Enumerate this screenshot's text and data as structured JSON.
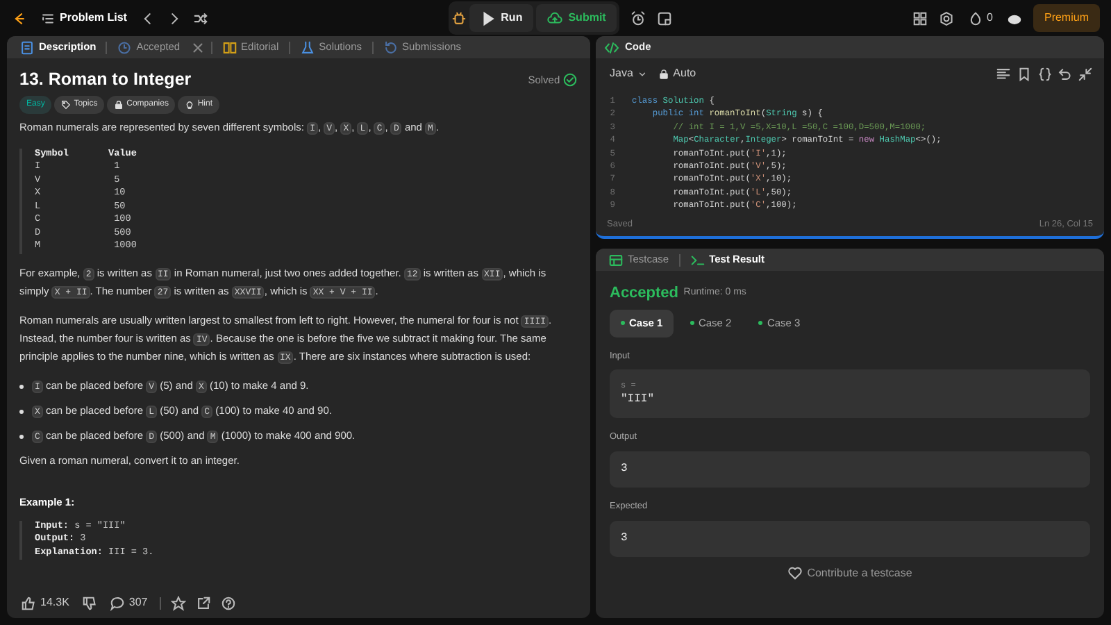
{
  "topbar": {
    "problem_list": "Problem List",
    "run": "Run",
    "submit": "Submit",
    "streak": "0",
    "premium": "Premium"
  },
  "description_tabs": [
    {
      "label": "Description",
      "selected": true,
      "closable": false
    },
    {
      "label": "Accepted",
      "selected": false,
      "closable": true
    },
    {
      "label": "Editorial",
      "selected": false,
      "closable": false
    },
    {
      "label": "Solutions",
      "selected": false,
      "closable": false
    },
    {
      "label": "Submissions",
      "selected": false,
      "closable": false
    }
  ],
  "problem": {
    "title": "13. Roman to Integer",
    "status": "Solved",
    "difficulty": "Easy",
    "tags": [
      "Topics",
      "Companies",
      "Hint"
    ],
    "blocks": [
      {
        "kind": "para",
        "parts": [
          {
            "kind": "text",
            "text": "Roman numerals are represented by seven different symbols: "
          },
          {
            "kind": "code",
            "text": "I"
          },
          {
            "kind": "text",
            "text": ", "
          },
          {
            "kind": "code",
            "text": "V"
          },
          {
            "kind": "text",
            "text": ", "
          },
          {
            "kind": "code",
            "text": "X"
          },
          {
            "kind": "text",
            "text": ", "
          },
          {
            "kind": "code",
            "text": "L"
          },
          {
            "kind": "text",
            "text": ", "
          },
          {
            "kind": "code",
            "text": "C"
          },
          {
            "kind": "text",
            "text": ", "
          },
          {
            "kind": "code",
            "text": "D"
          },
          {
            "kind": "text",
            "text": " and "
          },
          {
            "kind": "code",
            "text": "M"
          },
          {
            "kind": "text",
            "text": "."
          }
        ]
      },
      {
        "kind": "pre",
        "lines": [
          "**Symbol       Value**",
          "I             1",
          "V             5",
          "X             10",
          "L             50",
          "C             100",
          "D             500",
          "M             1000"
        ]
      },
      {
        "kind": "para",
        "parts": [
          {
            "kind": "text",
            "text": "For example, "
          },
          {
            "kind": "code",
            "text": "2"
          },
          {
            "kind": "text",
            "text": " is written as "
          },
          {
            "kind": "code",
            "text": "II"
          },
          {
            "kind": "text",
            "text": " in Roman numeral, just two ones added together. "
          },
          {
            "kind": "code",
            "text": "12"
          },
          {
            "kind": "text",
            "text": " is written as "
          },
          {
            "kind": "code",
            "text": "XII"
          },
          {
            "kind": "text",
            "text": ", which is simply "
          },
          {
            "kind": "code",
            "text": "X + II"
          },
          {
            "kind": "text",
            "text": ". The number "
          },
          {
            "kind": "code",
            "text": "27"
          },
          {
            "kind": "text",
            "text": " is written as "
          },
          {
            "kind": "code",
            "text": "XXVII"
          },
          {
            "kind": "text",
            "text": ", which is "
          },
          {
            "kind": "code",
            "text": "XX + V + II"
          },
          {
            "kind": "text",
            "text": "."
          }
        ]
      },
      {
        "kind": "para",
        "parts": [
          {
            "kind": "text",
            "text": "Roman numerals are usually written largest to smallest from left to right. However, the numeral for four is not "
          },
          {
            "kind": "code",
            "text": "IIII"
          },
          {
            "kind": "text",
            "text": ". Instead, the number four is written as "
          },
          {
            "kind": "code",
            "text": "IV"
          },
          {
            "kind": "text",
            "text": ". Because the one is before the five we subtract it making four. The same principle applies to the number nine, which is written as "
          },
          {
            "kind": "code",
            "text": "IX"
          },
          {
            "kind": "text",
            "text": ". There are six instances where subtraction is used:"
          }
        ]
      },
      {
        "kind": "bullet",
        "parts": [
          {
            "kind": "code",
            "text": "I"
          },
          {
            "kind": "text",
            "text": " can be placed before "
          },
          {
            "kind": "code",
            "text": "V"
          },
          {
            "kind": "text",
            "text": " (5) and "
          },
          {
            "kind": "code",
            "text": "X"
          },
          {
            "kind": "text",
            "text": " (10) to make 4 and 9."
          }
        ]
      },
      {
        "kind": "bullet",
        "parts": [
          {
            "kind": "code",
            "text": "X"
          },
          {
            "kind": "text",
            "text": " can be placed before "
          },
          {
            "kind": "code",
            "text": "L"
          },
          {
            "kind": "text",
            "text": " (50) and "
          },
          {
            "kind": "code",
            "text": "C"
          },
          {
            "kind": "text",
            "text": " (100) to make 40 and 90."
          }
        ]
      },
      {
        "kind": "bullet",
        "parts": [
          {
            "kind": "code",
            "text": "C"
          },
          {
            "kind": "text",
            "text": " can be placed before "
          },
          {
            "kind": "code",
            "text": "D"
          },
          {
            "kind": "text",
            "text": " (500) and "
          },
          {
            "kind": "code",
            "text": "M"
          },
          {
            "kind": "text",
            "text": " (1000) to make 400 and 900."
          }
        ]
      },
      {
        "kind": "para",
        "parts": [
          {
            "kind": "text",
            "text": "Given a roman numeral, convert it to an integer."
          }
        ]
      },
      {
        "kind": "heading",
        "text": "Example 1:"
      },
      {
        "kind": "pre",
        "lines": [
          "**Input:** s = \"III\"",
          "**Output:** 3",
          "**Explanation:** III = 3."
        ]
      }
    ]
  },
  "footer": {
    "likes": "14.3K",
    "comments": "307"
  },
  "code_panel": {
    "title": "Code",
    "language": "Java",
    "mode": "Auto",
    "saved": "Saved",
    "cursor": "Ln 26, Col 15",
    "lines": [
      {
        "number": "1",
        "tokens": [
          {
            "kind": "kw",
            "text": "class "
          },
          {
            "kind": "cls",
            "text": "Solution"
          },
          {
            "kind": "plain",
            "text": " {"
          }
        ]
      },
      {
        "number": "2",
        "tokens": [
          {
            "kind": "kw",
            "text": "    public int "
          },
          {
            "kind": "fn",
            "text": "romanToInt"
          },
          {
            "kind": "plain",
            "text": "("
          },
          {
            "kind": "cls",
            "text": "String"
          },
          {
            "kind": "plain",
            "text": " s) {"
          }
        ]
      },
      {
        "number": "3",
        "tokens": [
          {
            "kind": "comment",
            "text": "        // int I = 1,V =5,X=10,L =50,C =100,D=500,M=1000;"
          }
        ]
      },
      {
        "number": "4",
        "tokens": [
          {
            "kind": "cls",
            "text": "        Map"
          },
          {
            "kind": "plain",
            "text": "<"
          },
          {
            "kind": "cls",
            "text": "Character"
          },
          {
            "kind": "plain",
            "text": ","
          },
          {
            "kind": "cls",
            "text": "Integer"
          },
          {
            "kind": "plain",
            "text": "> romanToInt = "
          },
          {
            "kind": "new",
            "text": "new "
          },
          {
            "kind": "cls",
            "text": "HashMap"
          },
          {
            "kind": "plain",
            "text": "<>();"
          }
        ]
      },
      {
        "number": "5",
        "tokens": [
          {
            "kind": "plain",
            "text": "        romanToInt.put("
          },
          {
            "kind": "str",
            "text": "'I'"
          },
          {
            "kind": "plain",
            "text": ",1);"
          }
        ]
      },
      {
        "number": "6",
        "tokens": [
          {
            "kind": "plain",
            "text": "        romanToInt.put("
          },
          {
            "kind": "str",
            "text": "'V'"
          },
          {
            "kind": "plain",
            "text": ",5);"
          }
        ]
      },
      {
        "number": "7",
        "tokens": [
          {
            "kind": "plain",
            "text": "        romanToInt.put("
          },
          {
            "kind": "str",
            "text": "'X'"
          },
          {
            "kind": "plain",
            "text": ",10);"
          }
        ]
      },
      {
        "number": "8",
        "tokens": [
          {
            "kind": "plain",
            "text": "        romanToInt.put("
          },
          {
            "kind": "str",
            "text": "'L'"
          },
          {
            "kind": "plain",
            "text": ",50);"
          }
        ]
      },
      {
        "number": "9",
        "tokens": [
          {
            "kind": "plain",
            "text": "        romanToInt.put("
          },
          {
            "kind": "str",
            "text": "'C'"
          },
          {
            "kind": "plain",
            "text": ",100);"
          }
        ]
      }
    ]
  },
  "result_tabs": [
    {
      "label": "Testcase",
      "selected": false
    },
    {
      "label": "Test Result",
      "selected": true
    }
  ],
  "result": {
    "verdict": "Accepted",
    "runtime": "Runtime: 0 ms",
    "cases": [
      {
        "label": "Case 1",
        "selected": true
      },
      {
        "label": "Case 2",
        "selected": false
      },
      {
        "label": "Case 3",
        "selected": false
      }
    ],
    "input_label": "Input",
    "input_var": "s =",
    "input_value": "\"III\"",
    "output_label": "Output",
    "output_value": "3",
    "expected_label": "Expected",
    "expected_value": "3",
    "contribute": "Contribute a testcase"
  }
}
